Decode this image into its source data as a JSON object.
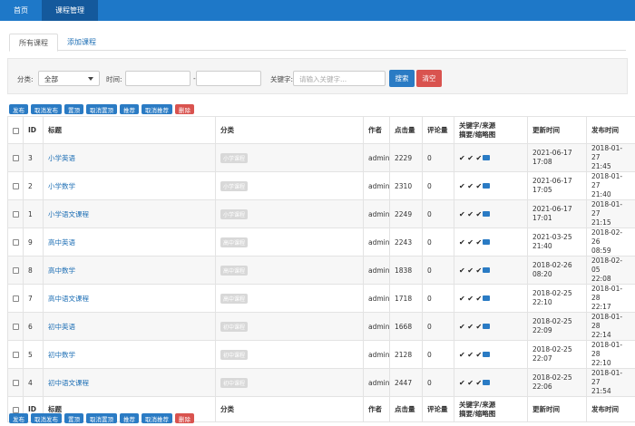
{
  "topnav": {
    "home": "首页",
    "course_manage": "课程管理"
  },
  "tabs": {
    "all": "所有课程",
    "add": "添加课程"
  },
  "filter": {
    "category_label": "分类:",
    "category_value": "全部",
    "time_label": "时间:",
    "time_sep": "-",
    "keyword_label": "关键字:",
    "keyword_placeholder": "请输入关键字...",
    "search_btn": "搜索",
    "clear_btn": "清空"
  },
  "actions": [
    "发布",
    "取消发布",
    "置顶",
    "取消置顶",
    "推荐",
    "取消推荐",
    "删除"
  ],
  "columns": {
    "id": "ID",
    "title": "标题",
    "category": "分类",
    "author": "作者",
    "clicks": "点击量",
    "comments": "评论量",
    "flags_line1": "关键字/来源",
    "flags_line2": "摘要/缩略图",
    "updated": "更新时间",
    "published": "发布时间"
  },
  "rows": [
    {
      "id": "3",
      "title": "小学英语",
      "category": "小学课程",
      "author": "admin",
      "clicks": "2229",
      "comments": "0",
      "updated_date": "2021-06-17",
      "updated_time": "17:08",
      "published_date": "2018-01-27",
      "published_time": "21:45"
    },
    {
      "id": "2",
      "title": "小学数学",
      "category": "小学课程",
      "author": "admin",
      "clicks": "2310",
      "comments": "0",
      "updated_date": "2021-06-17",
      "updated_time": "17:05",
      "published_date": "2018-01-27",
      "published_time": "21:40"
    },
    {
      "id": "1",
      "title": "小学语文课程",
      "category": "小学课程",
      "author": "admin",
      "clicks": "2249",
      "comments": "0",
      "updated_date": "2021-06-17",
      "updated_time": "17:01",
      "published_date": "2018-01-27",
      "published_time": "21:15"
    },
    {
      "id": "9",
      "title": "高中英语",
      "category": "高中课程",
      "author": "admin",
      "clicks": "2243",
      "comments": "0",
      "updated_date": "2021-03-25",
      "updated_time": "21:40",
      "published_date": "2018-02-26",
      "published_time": "08:59"
    },
    {
      "id": "8",
      "title": "高中数学",
      "category": "高中课程",
      "author": "admin",
      "clicks": "1838",
      "comments": "0",
      "updated_date": "2018-02-26",
      "updated_time": "08:20",
      "published_date": "2018-02-05",
      "published_time": "22:08"
    },
    {
      "id": "7",
      "title": "高中语文课程",
      "category": "高中课程",
      "author": "admin",
      "clicks": "1718",
      "comments": "0",
      "updated_date": "2018-02-25",
      "updated_time": "22:10",
      "published_date": "2018-01-28",
      "published_time": "22:17"
    },
    {
      "id": "6",
      "title": "初中英语",
      "category": "初中课程",
      "author": "admin",
      "clicks": "1668",
      "comments": "0",
      "updated_date": "2018-02-25",
      "updated_time": "22:09",
      "published_date": "2018-01-28",
      "published_time": "22:14"
    },
    {
      "id": "5",
      "title": "初中数学",
      "category": "初中课程",
      "author": "admin",
      "clicks": "2128",
      "comments": "0",
      "updated_date": "2018-02-25",
      "updated_time": "22:07",
      "published_date": "2018-01-28",
      "published_time": "22:10"
    },
    {
      "id": "4",
      "title": "初中语文课程",
      "category": "初中课程",
      "author": "admin",
      "clicks": "2447",
      "comments": "0",
      "updated_date": "2018-02-25",
      "updated_time": "22:06",
      "published_date": "2018-01-27",
      "published_time": "21:54"
    }
  ],
  "colors": {
    "primary": "#1e78c8",
    "danger": "#d9534f",
    "link": "#1e6fb5"
  }
}
